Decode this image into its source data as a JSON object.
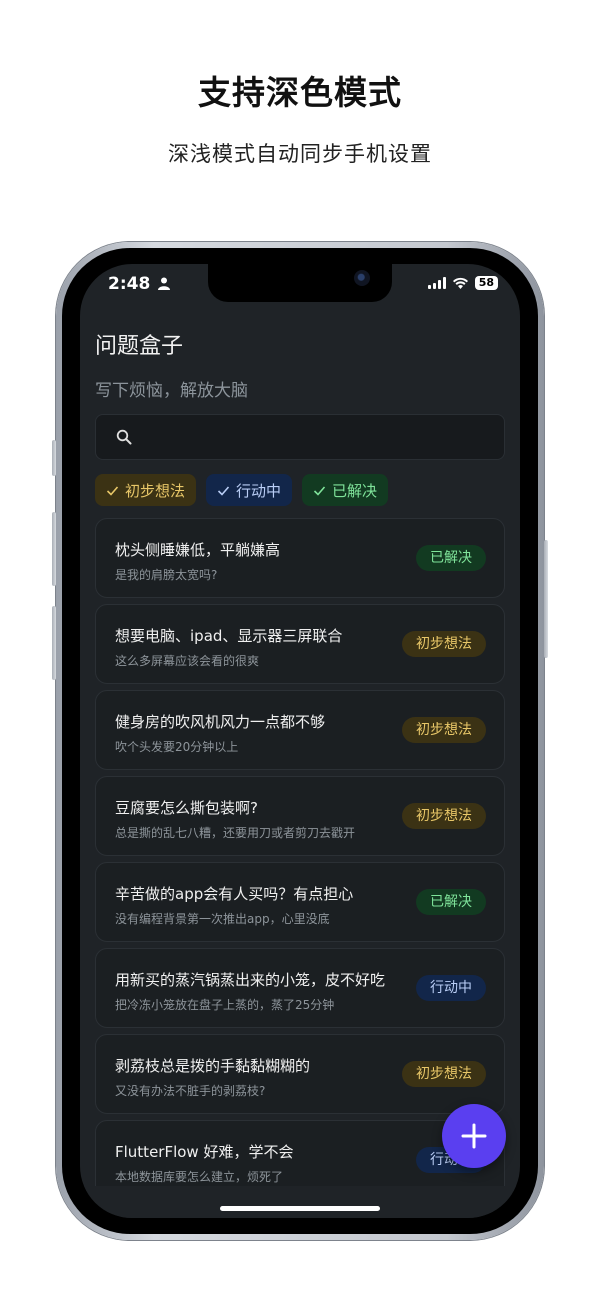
{
  "promo": {
    "headline": "支持深色模式",
    "subline": "深浅模式自动同步手机设置"
  },
  "status_bar": {
    "time": "2:48",
    "battery": "58",
    "icons": [
      "person-icon",
      "signal-icon",
      "wifi-icon",
      "battery-icon"
    ]
  },
  "app": {
    "title": "问题盒子",
    "subtitle": "写下烦恼，解放大脑",
    "search_placeholder": ""
  },
  "filters": [
    {
      "label": "初步想法",
      "color": "#e8c768"
    },
    {
      "label": "行动中",
      "color": "#b9cdf5"
    },
    {
      "label": "已解决",
      "color": "#7fe39a"
    }
  ],
  "items": [
    {
      "title": "枕头侧睡嫌低，平躺嫌高",
      "subtitle": "是我的肩膀太宽吗?",
      "status": "已解决"
    },
    {
      "title": "想要电脑、ipad、显示器三屏联合",
      "subtitle": "这么多屏幕应该会看的很爽",
      "status": "初步想法"
    },
    {
      "title": "健身房的吹风机风力一点都不够",
      "subtitle": "吹个头发要20分钟以上",
      "status": "初步想法"
    },
    {
      "title": "豆腐要怎么撕包装啊?",
      "subtitle": "总是撕的乱七八糟，还要用刀或者剪刀去戳开",
      "status": "初步想法"
    },
    {
      "title": "辛苦做的app会有人买吗？有点担心",
      "subtitle": "没有编程背景第一次推出app，心里没底",
      "status": "已解决"
    },
    {
      "title": "用新买的蒸汽锅蒸出来的小笼，皮不好吃",
      "subtitle": "把冷冻小笼放在盘子上蒸的，蒸了25分钟",
      "status": "行动中"
    },
    {
      "title": "剥荔枝总是拨的手黏黏糊糊的",
      "subtitle": "又没有办法不脏手的剥荔枝?",
      "status": "初步想法"
    },
    {
      "title": "FlutterFlow 好难，学不会",
      "subtitle": "本地数据库要怎么建立，烦死了",
      "status": "行动中"
    }
  ],
  "colors": {
    "background": "#1f2327",
    "card": "#1b1f22",
    "fab": "#5a3ff0"
  }
}
